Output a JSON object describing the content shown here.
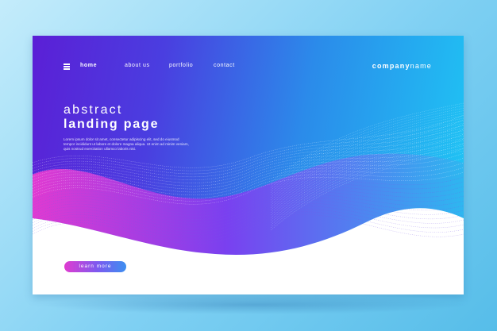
{
  "nav": {
    "items": [
      {
        "label": "home"
      },
      {
        "label": "about us"
      },
      {
        "label": "portfolio"
      },
      {
        "label": "contact"
      }
    ]
  },
  "brand": {
    "bold": "company",
    "light": "name"
  },
  "hero": {
    "subtitle": "abstract",
    "title": "landing page",
    "body": "Lorem ipsum dolor sit amet, consectetur adipiscing elit, sed do eiusmod tempor incididunt ut labore et dolore magna aliqua. Ut enim ad minim veniam, quis nostrud exercitation ullamco laboris nisi."
  },
  "cta": {
    "label": "learn more"
  },
  "colors": {
    "accent_pink": "#e03bd0",
    "accent_purple": "#5b1fd6",
    "accent_cyan": "#1ec9f5"
  },
  "icons": {
    "menu": "hamburger-menu-icon"
  }
}
